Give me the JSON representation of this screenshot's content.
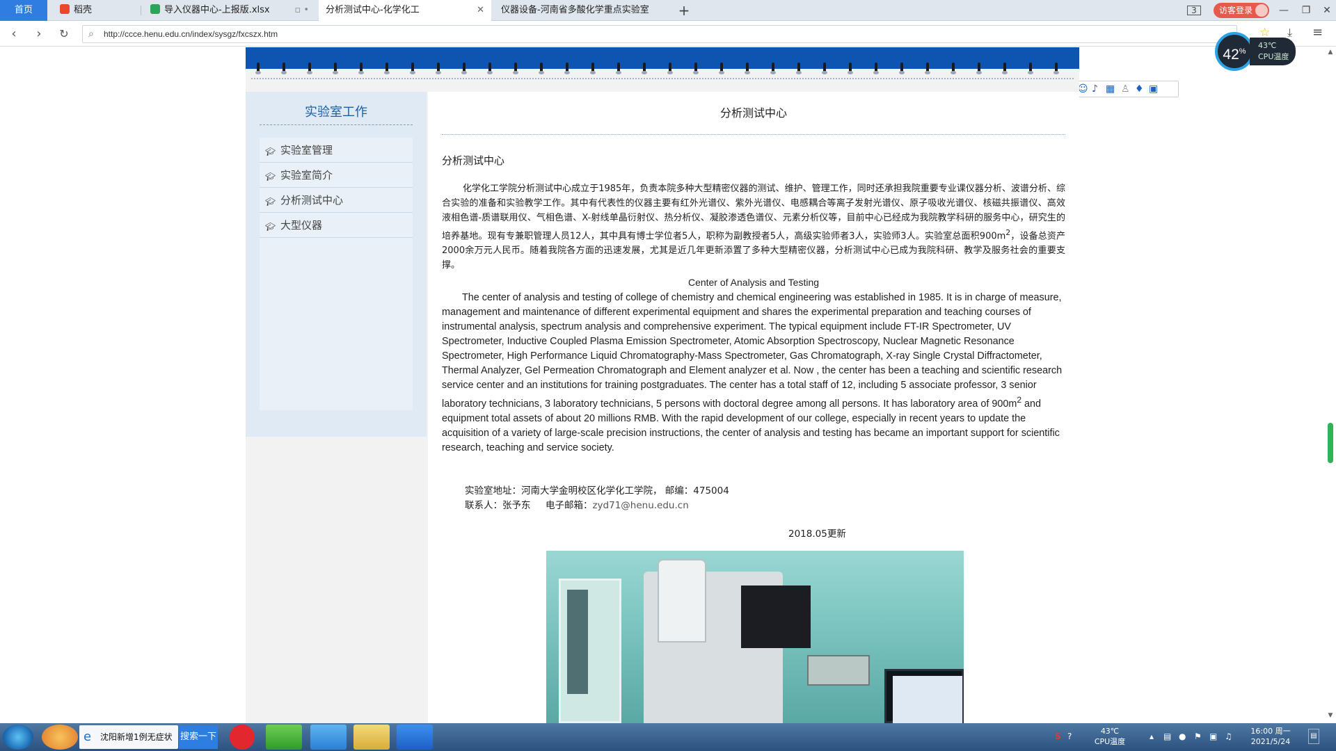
{
  "tabs": [
    {
      "label": "首页",
      "active": false
    },
    {
      "label": "稻壳",
      "active": false
    },
    {
      "label": "导入仪器中心-上报版.xlsx",
      "active": false
    },
    {
      "label": "分析测试中心-化学化工",
      "active": true
    },
    {
      "label": "仪器设备-河南省多酸化学重点实验室",
      "active": false
    }
  ],
  "browser": {
    "new_tab": "+",
    "login_label": "访客登录",
    "url": "http://ccce.henu.edu.cn/index/sysgz/fxcszx.htm",
    "cpu_percent": "42",
    "cpu_temp": "43℃",
    "cpu_temp_label": "CPU温度"
  },
  "ime": {
    "mode": "中",
    "punct": "°,"
  },
  "sidebar": {
    "title": "实验室工作",
    "items": [
      {
        "label": "实验室管理"
      },
      {
        "label": "实验室简介"
      },
      {
        "label": "分析测试中心"
      },
      {
        "label": "大型仪器"
      }
    ]
  },
  "content": {
    "title": "分析测试中心",
    "subtitle": "分析测试中心",
    "cn_paragraph_a": "化学化工学院分析测试中心成立于1985年，负责本院多种大型精密仪器的测试、维护、管理工作，同时还承担我院重要专业课仪器分析、波谱分析、综合实验的准备和实验教学工作。其中有代表性的仪器主要有红外光谱仪、紫外光谱仪、电感耦合等离子发射光谱仪、原子吸收光谱仪、核磁共振谱仪、高效液相色谱-质谱联用仪、气相色谱、X-射线单晶衍射仪、热分析仪、凝胶渗透色谱仪、元素分析仪等，目前中心已经成为我院教学科研的服务中心，研究生的培养基地。现有专兼职管理人员12人，其中具有博士学位者5人，职称为副教授者5人，高级实验师者3人，实验师3人。实验室总面积900m",
    "cn_sup": "2",
    "cn_paragraph_b": "，设备总资产2000余万元人民币。随着我院各方面的迅速发展，尤其是近几年更新添置了多种大型精密仪器，分析测试中心已成为我院科研、教学及服务社会的重要支撑。",
    "en_title": "Center of Analysis and Testing",
    "en_paragraph_a": "The center of analysis and testing of college of chemistry and chemical engineering was established in 1985. It is in charge of measure, management and maintenance of different experimental equipment and shares the experimental preparation and teaching courses of instrumental analysis, spectrum analysis and comprehensive experiment. The typical equipment include FT-IR Spectrometer, UV Spectrometer, Inductive Coupled Plasma Emission Spectrometer, Atomic Absorption Spectroscopy, Nuclear Magnetic Resonance Spectrometer, High Performance Liquid Chromatography-Mass Spectrometer, Gas Chromatograph, X-ray Single Crystal Diffractometer, Thermal Analyzer, Gel Permeation Chromatograph and Element analyzer et al. Now , the center has been a teaching and scientific research service center and an institutions for training postgraduates. The center has a total staff of 12, including 5 associate professor, 3 senior laboratory technicians, 3 laboratory technicians, 5 persons with doctoral degree among all persons. It has laboratory area of 900m",
    "en_sup": "2",
    "en_paragraph_b": " and equipment total assets of about 20 millions RMB. With the rapid development of our college, especially in recent years to update the acquisition of a variety of large-scale precision instructions, the center of analysis and testing has became an important support for scientific research, teaching and service society.",
    "address_line": "实验室地址：河南大学金明校区化学化工学院， 邮编：475004",
    "contact_prefix": "联系人：张予东     电子邮箱：",
    "email": "zyd71@henu.edu.cn",
    "update_note": "2018.05更新"
  },
  "taskbar": {
    "ie_item": "沈阳新增1例无症状",
    "search_btn": "搜索一下",
    "temp": "43℃",
    "temp_label": "CPU温度",
    "time": "16:00 周一",
    "date": "2021/5/24"
  },
  "colors": {
    "banner": "#0d55b0",
    "sidebar": "#dfeaf4",
    "accent": "#1d5fa4",
    "login": "#e55a4d",
    "active_home": "#2f7de1"
  }
}
